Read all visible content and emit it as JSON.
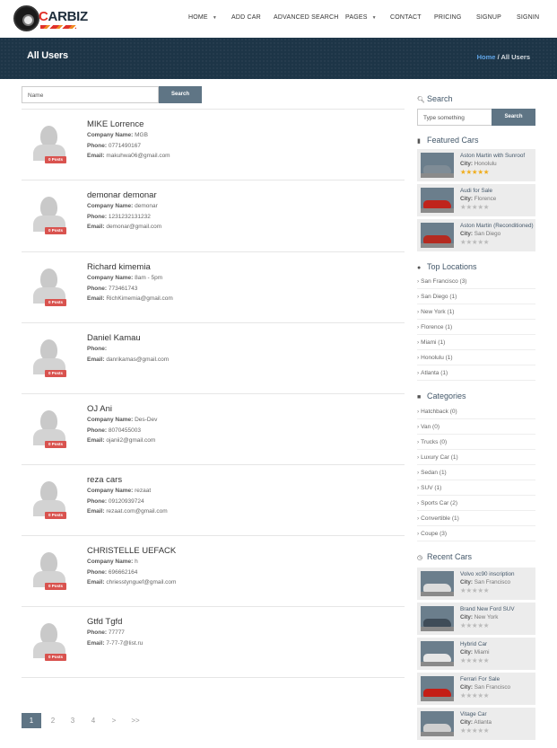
{
  "brand": {
    "name": "CARBIZ"
  },
  "nav": [
    {
      "label": "HOME",
      "dropdown": true
    },
    {
      "label": "ADD CAR",
      "dropdown": false
    },
    {
      "label": "ADVANCED SEARCH",
      "dropdown": false
    },
    {
      "label": "PAGES",
      "dropdown": true
    },
    {
      "label": "CONTACT",
      "dropdown": false
    },
    {
      "label": "PRICING",
      "dropdown": false
    },
    {
      "label": "SIGNUP",
      "dropdown": false
    },
    {
      "label": "SIGNIN",
      "dropdown": false
    }
  ],
  "banner": {
    "title": "All Users",
    "crumb_home": "Home",
    "crumb_sep": " / ",
    "crumb_current": "All Users"
  },
  "main_search": {
    "placeholder": "Name",
    "button": "Search"
  },
  "labels": {
    "company": "Company Name:",
    "phone": "Phone:",
    "email": "Email:"
  },
  "users": [
    {
      "name": "MIKE Lorrence",
      "posts": "0 Posts",
      "company": "MGB",
      "phone": "0771490167",
      "email": "makuhwa06@gmail.com"
    },
    {
      "name": "demonar demonar",
      "posts": "0 Posts",
      "company": "demonar",
      "phone": "1231232131232",
      "email": "demonar@gmail.com"
    },
    {
      "name": "Richard kimemia",
      "posts": "0 Posts",
      "company": "8am - 5pm",
      "phone": "773461743",
      "email": "RichKimemia@gmail.com"
    },
    {
      "name": "Daniel Kamau",
      "posts": "0 Posts",
      "company": null,
      "phone": "",
      "email": "danrikamas@gmail.com"
    },
    {
      "name": "OJ Ani",
      "posts": "0 Posts",
      "company": "Des-Dev",
      "phone": "8070455003",
      "email": "ojanii2@gmail.com"
    },
    {
      "name": "reza cars",
      "posts": "0 Posts",
      "company": "rezaat",
      "phone": "09120939724",
      "email": "rezaat.com@gmail.com"
    },
    {
      "name": "CHRISTELLE UEFACK",
      "posts": "0 Posts",
      "company": "h",
      "phone": "696662164",
      "email": "chriesstynguef@gmail.com"
    },
    {
      "name": "Gtfd Tgfd",
      "posts": "0 Posts",
      "company": null,
      "phone": "77777",
      "email": "7-77-7@list.ru"
    }
  ],
  "pagination": [
    "1",
    "2",
    "3",
    "4",
    ">",
    ">>"
  ],
  "pagination_active": "1",
  "sidebar": {
    "search": {
      "title": "Search",
      "placeholder": "Type something",
      "button": "Search"
    },
    "featured": {
      "title": "Featured Cars",
      "items": [
        {
          "title": "Aston Martin with Sunroof",
          "city": "Honolulu",
          "rating": 4.5,
          "color": "#7f8c96"
        },
        {
          "title": "Audi for Sale",
          "city": "Florence",
          "rating": 0,
          "color": "#c0241c"
        },
        {
          "title": "Aston Martin (Reconditioned)",
          "city": "San Diego",
          "rating": 0,
          "color": "#b52a20"
        }
      ]
    },
    "locations": {
      "title": "Top Locations",
      "items": [
        "San Francisco (3)",
        "San Diego (1)",
        "New York (1)",
        "Florence (1)",
        "Miami (1)",
        "Honolulu (1)",
        "Atlanta (1)"
      ]
    },
    "categories": {
      "title": "Categories",
      "items": [
        "Hatchback (0)",
        "Van (0)",
        "Trucks (0)",
        "Luxury Car (1)",
        "Sedan (1)",
        "SUV (1)",
        "Sports Car (2)",
        "Convertible (1)",
        "Coupe (3)"
      ]
    },
    "recent": {
      "title": "Recent Cars",
      "items": [
        {
          "title": "Volvo xc90 inscription",
          "city": "San Francisco",
          "rating": 0,
          "color": "#dcdcdc"
        },
        {
          "title": "Brand New Ford SUV",
          "city": "New York",
          "rating": 0,
          "color": "#3f4c58"
        },
        {
          "title": "Hybrid Car",
          "city": "Miami",
          "rating": 0,
          "color": "#e6e6e6"
        },
        {
          "title": "Ferrari For Sale",
          "city": "San Francisco",
          "rating": 0,
          "color": "#c41e16"
        },
        {
          "title": "Vitage Car",
          "city": "Atlanta",
          "rating": 0,
          "color": "#cfcfcf"
        }
      ]
    },
    "city_label": "City:"
  }
}
